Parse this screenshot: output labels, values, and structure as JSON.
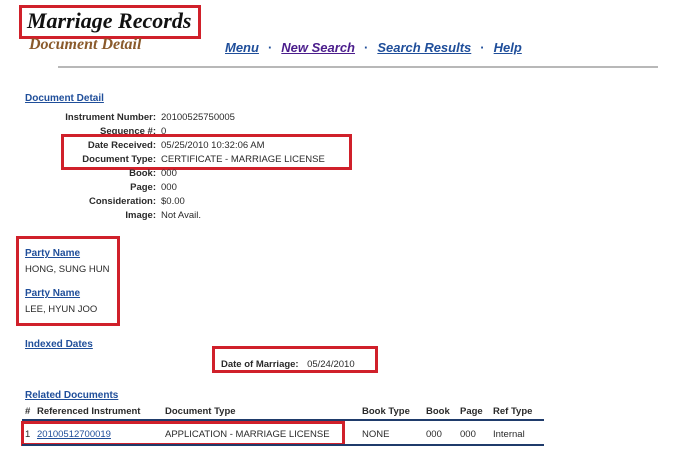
{
  "header": {
    "title": "Marriage Records",
    "subtitle": "Document Detail"
  },
  "nav": {
    "menu": "Menu",
    "new_search": "New Search",
    "search_results": "Search Results",
    "help": "Help",
    "separator": "·"
  },
  "document_detail": {
    "section_title": "Document Detail",
    "instrument_number_label": "Instrument Number:",
    "instrument_number": "20100525750005",
    "sequence_label": "Sequence #:",
    "sequence": "0",
    "date_received_label": "Date Received:",
    "date_received": "05/25/2010 10:32:06 AM",
    "document_type_label": "Document Type:",
    "document_type": "CERTIFICATE - MARRIAGE LICENSE",
    "book_label": "Book:",
    "book": "000",
    "page_label": "Page:",
    "page": "000",
    "consideration_label": "Consideration:",
    "consideration": "$0.00",
    "image_label": "Image:",
    "image": "Not Avail."
  },
  "parties": [
    {
      "label": "Party Name",
      "name": "HONG, SUNG HUN"
    },
    {
      "label": "Party Name",
      "name": "LEE, HYUN JOO"
    }
  ],
  "indexed_dates": {
    "section_title": "Indexed Dates",
    "date_of_marriage_label": "Date of Marriage:",
    "date_of_marriage": "05/24/2010"
  },
  "related_documents": {
    "section_title": "Related Documents",
    "columns": [
      "#",
      "Referenced Instrument",
      "Document Type",
      "Book Type",
      "Book",
      "Page",
      "Ref Type"
    ],
    "rows": [
      {
        "num": "1",
        "instrument": "20100512700019",
        "document_type": "APPLICATION - MARRIAGE LICENSE",
        "book_type": "NONE",
        "book": "000",
        "page": "000",
        "ref_type": "Internal"
      }
    ]
  },
  "colors": {
    "highlight": "#d0202a",
    "link": "#1f4e9a",
    "visited_link": "#4b1d8c",
    "subtitle": "#8a5a2b",
    "table_rule": "#1f3b6b"
  }
}
